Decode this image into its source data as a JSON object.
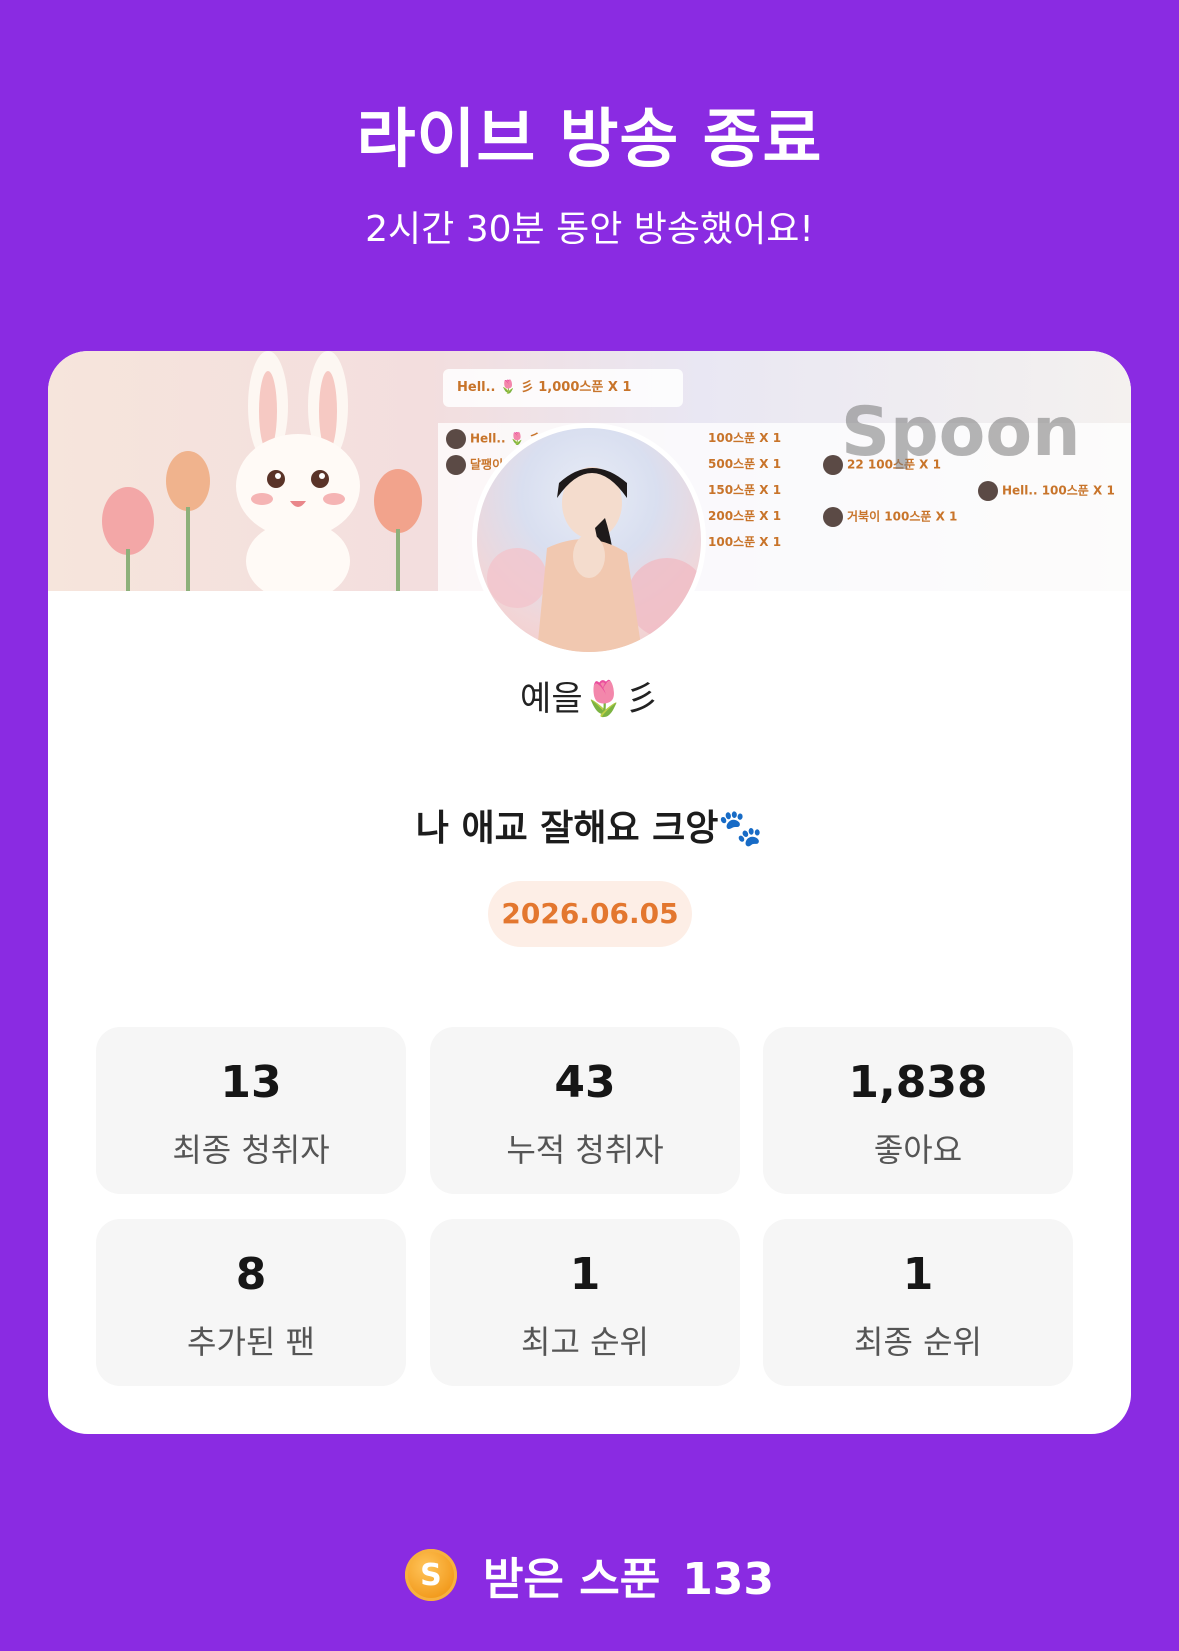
{
  "header": {
    "title": "라이브 방송 종료",
    "subtitle": "2시간 30분 동안 방송했어요!"
  },
  "banner": {
    "brand": "Spoon",
    "feed_top": "Hell.. 🌷 彡  1,000스푼 X 1",
    "feed_rows": [
      "Hell.. 🌷 彡",
      "달팽이",
      "100스푼 X 1",
      "500스푼 X 1",
      "150스푼 X 1",
      "200스푼 X 1",
      "100스푼 X 1",
      "22   100스푼 X 1",
      "거북이   100스푼 X 1",
      "Hell..   100스푼 X 1"
    ]
  },
  "profile": {
    "nickname": "예을🌷彡"
  },
  "live": {
    "title": "나 애교 잘해요 크앙🐾",
    "date": "2026.06.05"
  },
  "stats": [
    {
      "value": "13",
      "label": "최종 청취자"
    },
    {
      "value": "43",
      "label": "누적 청취자"
    },
    {
      "value": "1,838",
      "label": "좋아요"
    },
    {
      "value": "8",
      "label": "추가된 팬"
    },
    {
      "value": "1",
      "label": "최고 순위"
    },
    {
      "value": "1",
      "label": "최종 순위"
    }
  ],
  "footer": {
    "coin_letter": "S",
    "label": "받은 스푼",
    "count": "133"
  },
  "colors": {
    "background": "#8a2be2",
    "card": "#ffffff",
    "date_text": "#e3772f",
    "date_bg": "#fdeee6",
    "stat_bg": "#f6f6f6",
    "coin": "#f29a1c"
  }
}
